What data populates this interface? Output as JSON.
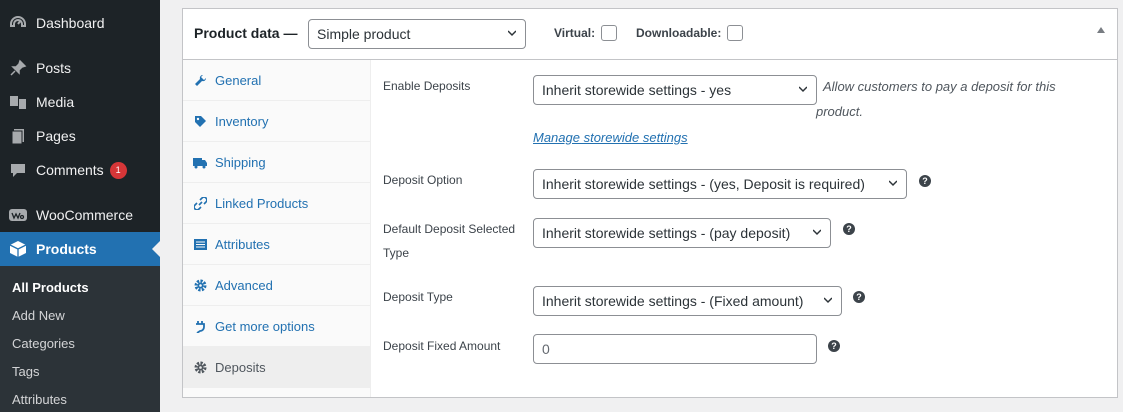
{
  "sidebar": {
    "items": [
      {
        "label": "Dashboard",
        "icon": "dashboard-icon"
      },
      {
        "label": "Posts",
        "icon": "pin-icon"
      },
      {
        "label": "Media",
        "icon": "media-icon"
      },
      {
        "label": "Pages",
        "icon": "pages-icon"
      },
      {
        "label": "Comments",
        "icon": "comment-icon",
        "badge": "1"
      },
      {
        "label": "WooCommerce",
        "icon": "woo-icon"
      },
      {
        "label": "Products",
        "icon": "box-icon"
      }
    ],
    "submenu": [
      "All Products",
      "Add New",
      "Categories",
      "Tags",
      "Attributes"
    ]
  },
  "product_data": {
    "title": "Product data —",
    "type_select": "Simple product",
    "virtual_label": "Virtual:",
    "downloadable_label": "Downloadable:"
  },
  "tabs": [
    {
      "label": "General",
      "icon": "wrench-icon"
    },
    {
      "label": "Inventory",
      "icon": "tag-icon"
    },
    {
      "label": "Shipping",
      "icon": "truck-icon"
    },
    {
      "label": "Linked Products",
      "icon": "link-icon"
    },
    {
      "label": "Attributes",
      "icon": "list-icon"
    },
    {
      "label": "Advanced",
      "icon": "gear-icon"
    },
    {
      "label": "Get more options",
      "icon": "plugin-icon"
    },
    {
      "label": "Deposits",
      "icon": "gear-icon"
    }
  ],
  "fields": {
    "enable_deposits": {
      "label": "Enable Deposits",
      "value": "Inherit storewide settings - yes",
      "desc_line1": "Allow customers to pay a deposit for this",
      "desc_line2": "product.",
      "link": "Manage storewide settings"
    },
    "deposit_option": {
      "label": "Deposit Option",
      "value": "Inherit storewide settings - (yes, Deposit is required)"
    },
    "default_type": {
      "label_line1": "Default Deposit Selected",
      "label_line2": "Type",
      "value": "Inherit storewide settings - (pay deposit)"
    },
    "deposit_type": {
      "label": "Deposit Type",
      "value": "Inherit storewide settings - (Fixed amount)"
    },
    "fixed_amount": {
      "label": "Deposit Fixed Amount",
      "placeholder": "0"
    },
    "help_glyph": "?"
  },
  "colors": {
    "accent": "#2271b1",
    "sidebar": "#1d2327",
    "badge": "#d63638"
  }
}
